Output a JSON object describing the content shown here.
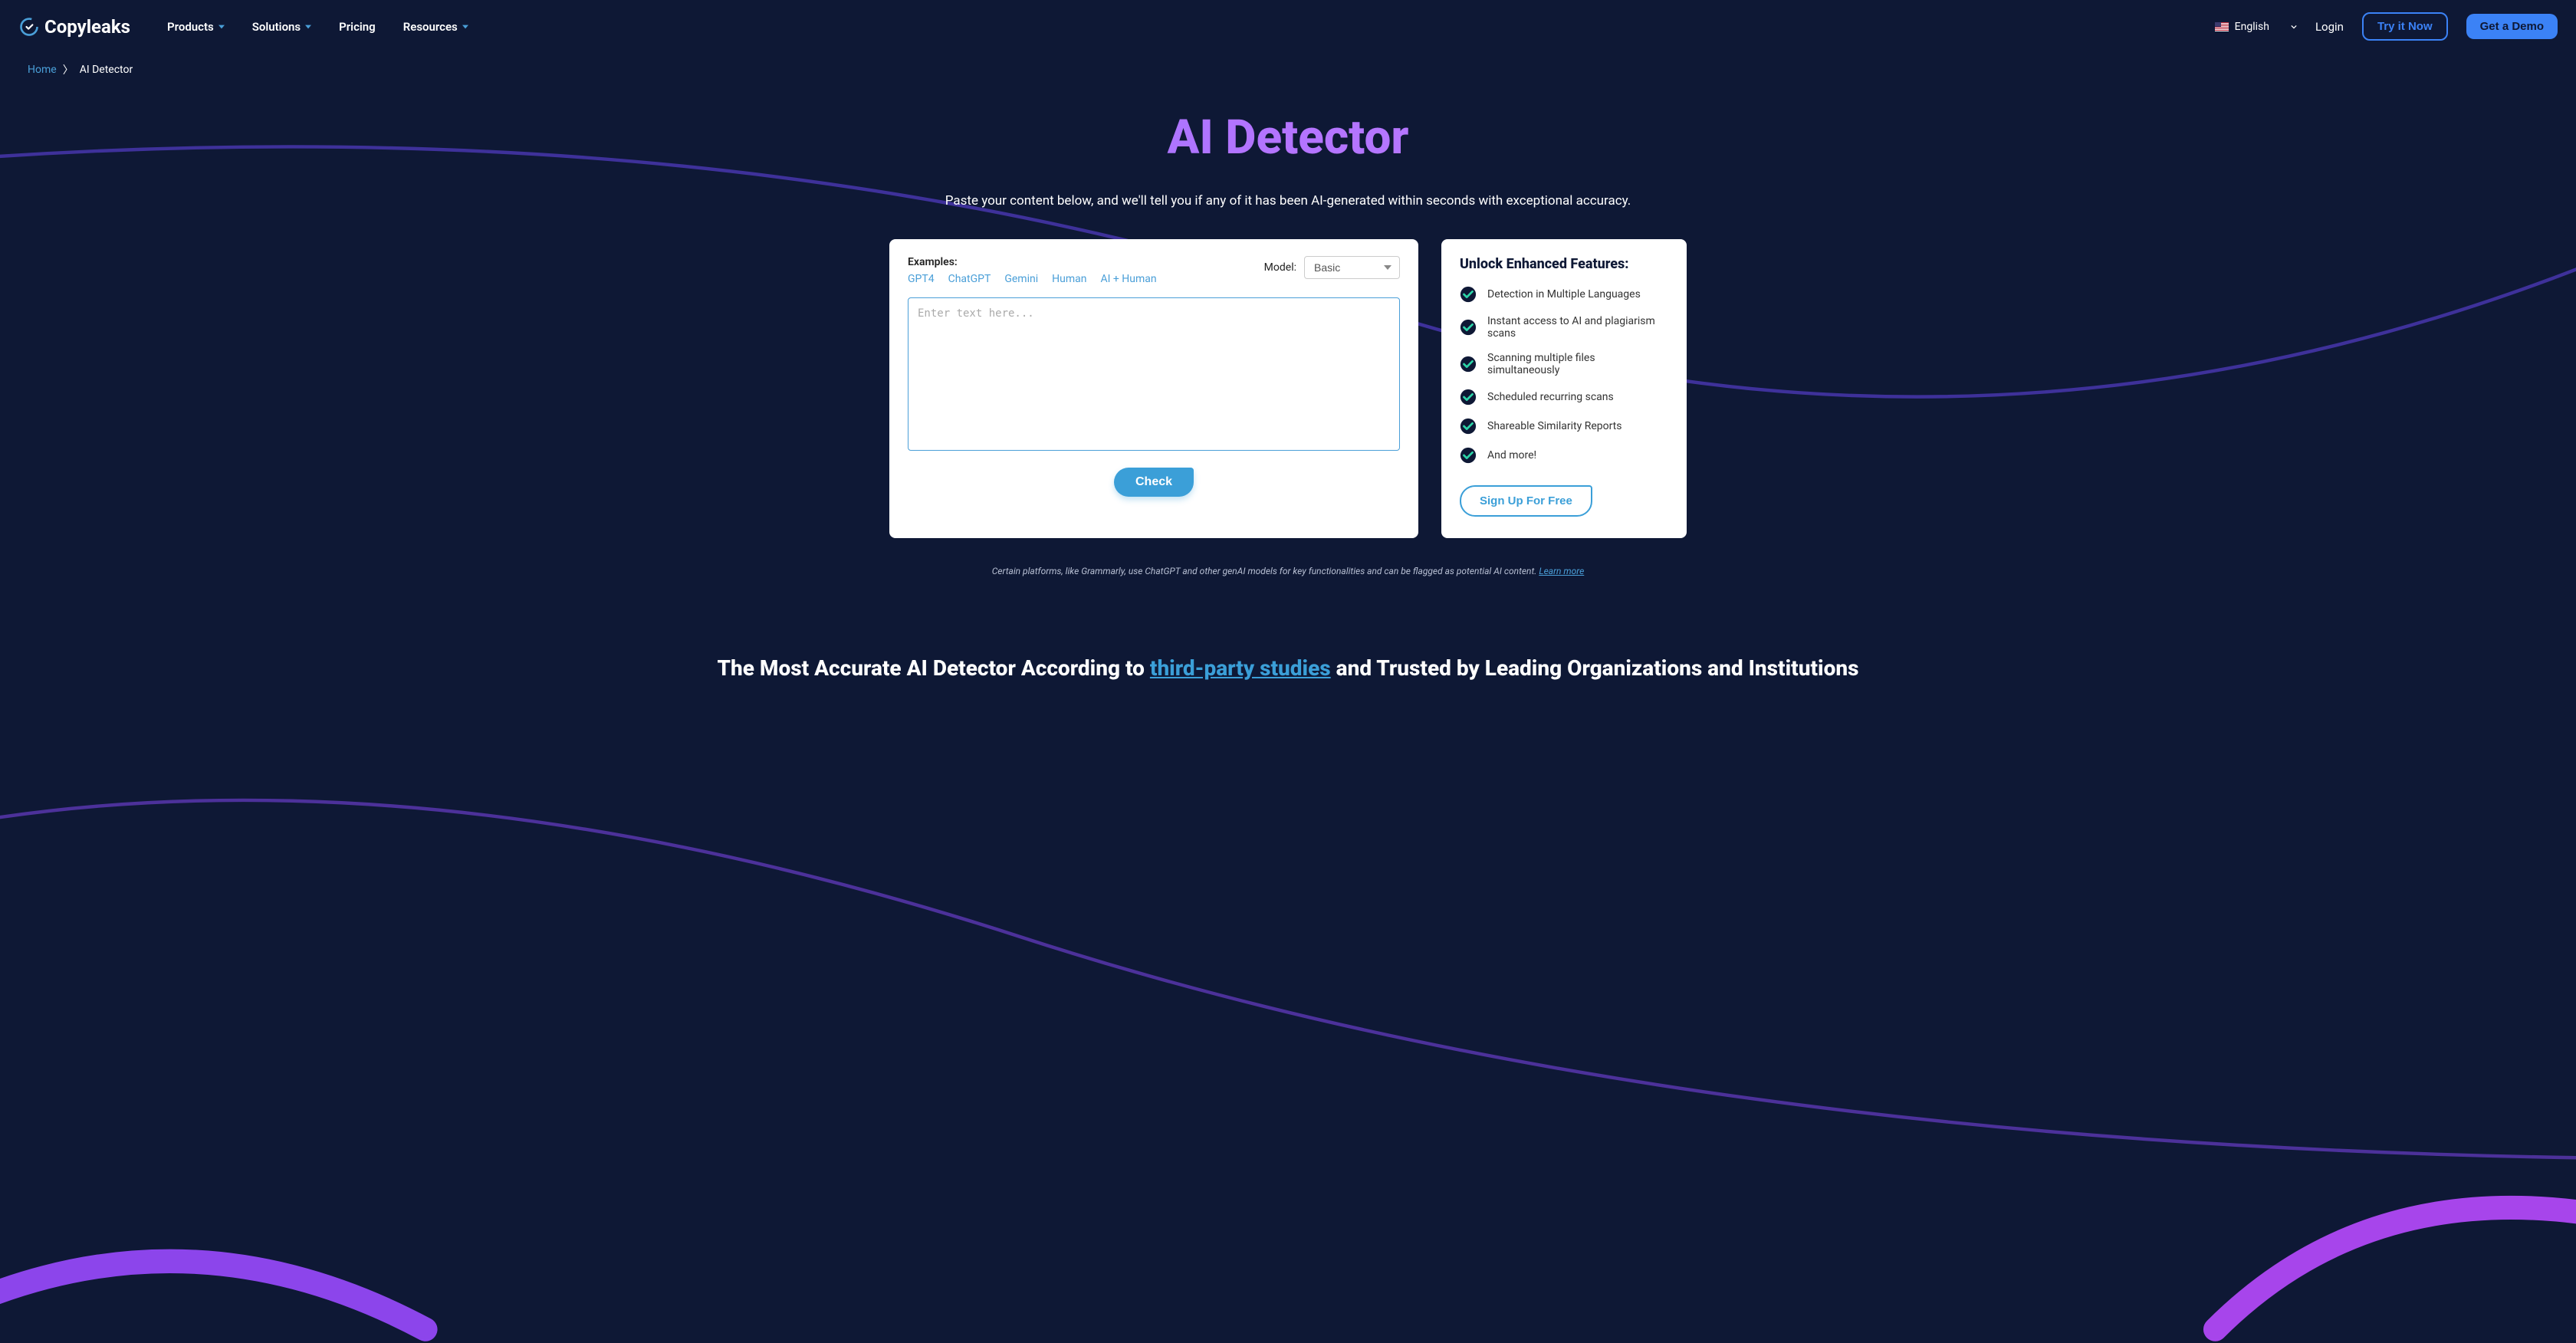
{
  "header": {
    "logo": "Copyleaks",
    "nav": [
      "Products",
      "Solutions",
      "Pricing",
      "Resources"
    ],
    "nav_has_dropdown": [
      true,
      true,
      false,
      true
    ],
    "language": "English",
    "login": "Login",
    "try": "Try it Now",
    "demo": "Get a Demo"
  },
  "breadcrumb": {
    "home": "Home",
    "current": "AI Detector"
  },
  "hero": {
    "title": "AI Detector",
    "subtitle": "Paste your content below, and we'll tell you if any of it has been AI-generated within seconds with exceptional accuracy."
  },
  "main_panel": {
    "examples_label": "Examples:",
    "examples": [
      "GPT4",
      "ChatGPT",
      "Gemini",
      "Human",
      "AI + Human"
    ],
    "model_label": "Model:",
    "model_value": "Basic",
    "placeholder": "Enter text here...",
    "check_label": "Check"
  },
  "side_panel": {
    "title": "Unlock Enhanced Features:",
    "features": [
      "Detection in Multiple Languages",
      "Instant access to AI and plagiarism scans",
      "Scanning multiple files simultaneously",
      "Scheduled recurring scans",
      "Shareable Similarity Reports",
      "And more!"
    ],
    "signup_label": "Sign Up For Free"
  },
  "note": {
    "text": "Certain platforms, like Grammarly, use ChatGPT and other genAI models for key functionalities and can be flagged as potential AI content. ",
    "link": "Learn more "
  },
  "bottom": {
    "prefix": "The Most Accurate AI Detector According to ",
    "link": "third-party studies",
    "suffix": " and Trusted by Leading Organizations and Institutions"
  }
}
